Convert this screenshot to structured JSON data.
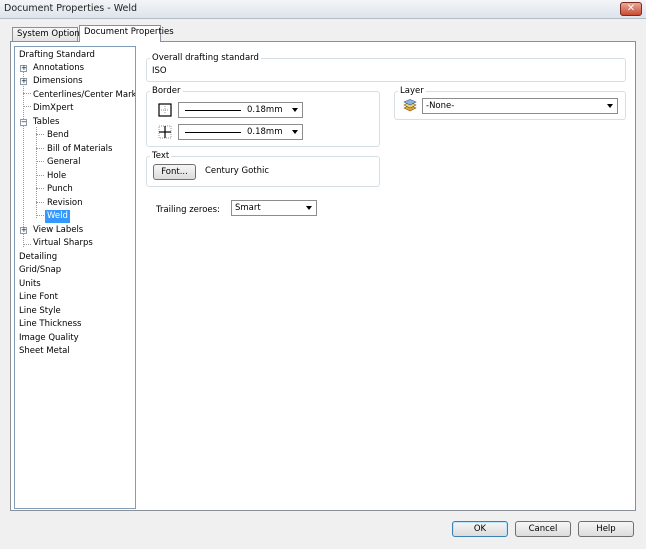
{
  "window": {
    "title": "Document Properties - Weld",
    "close_glyph": "✕"
  },
  "tabs": [
    {
      "label": "System Options"
    },
    {
      "label": "Document Properties"
    }
  ],
  "tree": {
    "items": [
      {
        "label": "Drafting Standard"
      },
      {
        "label": "Annotations"
      },
      {
        "label": "Dimensions"
      },
      {
        "label": "Centerlines/Center Marks"
      },
      {
        "label": "DimXpert"
      },
      {
        "label": "Tables"
      },
      {
        "label": "Bend"
      },
      {
        "label": "Bill of Materials"
      },
      {
        "label": "General"
      },
      {
        "label": "Hole"
      },
      {
        "label": "Punch"
      },
      {
        "label": "Revision"
      },
      {
        "label": "Weld"
      },
      {
        "label": "View Labels"
      },
      {
        "label": "Virtual Sharps"
      },
      {
        "label": "Detailing"
      },
      {
        "label": "Grid/Snap"
      },
      {
        "label": "Units"
      },
      {
        "label": "Line Font"
      },
      {
        "label": "Line Style"
      },
      {
        "label": "Line Thickness"
      },
      {
        "label": "Image Quality"
      },
      {
        "label": "Sheet Metal"
      }
    ],
    "expand_glyph": "+",
    "collapse_glyph": "−"
  },
  "drafting": {
    "label": "Overall drafting standard",
    "value": "ISO"
  },
  "border": {
    "label": "Border",
    "outer_value": "0.18mm",
    "inner_value": "0.18mm"
  },
  "layer": {
    "label": "Layer",
    "value": "-None-"
  },
  "text": {
    "label": "Text",
    "font_button": "Font...",
    "font_name": "Century Gothic"
  },
  "trailing": {
    "label": "Trailing zeroes:",
    "value": "Smart"
  },
  "buttons": {
    "ok": "OK",
    "cancel": "Cancel",
    "help": "Help"
  },
  "icons": {
    "close": "close-icon",
    "border_outer": "border-outer-icon",
    "border_inner": "border-inner-icon",
    "layer": "layer-icon"
  }
}
